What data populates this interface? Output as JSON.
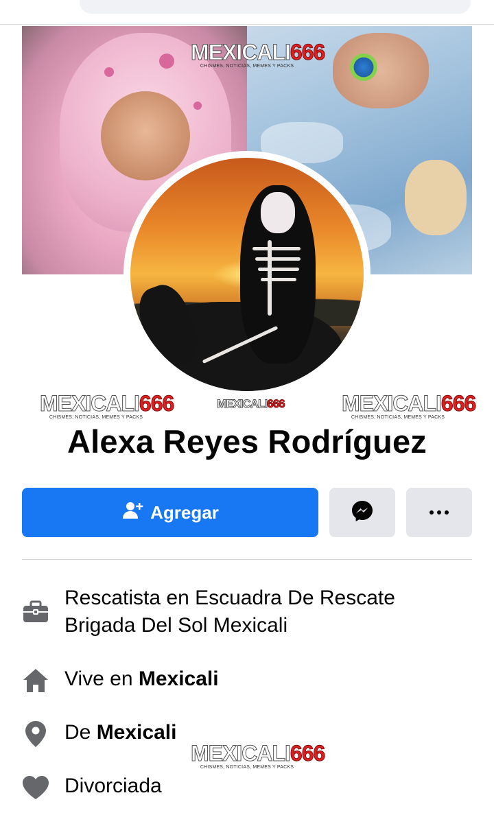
{
  "watermark": {
    "brand": "MEXICALI",
    "number": "666",
    "tagline": "CHISMES, NOTICIAS, MEMES Y PACKS"
  },
  "profile": {
    "name": "Alexa Reyes Rodríguez"
  },
  "actions": {
    "add_label": "Agregar",
    "add_icon": "add-friend-icon",
    "message_icon": "messenger-icon",
    "more_icon": "more-dots-icon"
  },
  "details": {
    "work": "Rescatista en Escuadra De Rescate Brigada Del Sol Mexicali",
    "work_line1": "Rescatista en Escuadra De Rescate",
    "work_line2": "Brigada Del Sol Mexicali",
    "lives_prefix": "Vive en ",
    "lives_city": "Mexicali",
    "from_prefix": "De ",
    "from_city": "Mexicali",
    "relationship": "Divorciada"
  },
  "colors": {
    "primary": "#1877f2",
    "secondary_button": "#e4e6eb",
    "icon_gray": "#65676b",
    "watermark_red": "#e02020"
  }
}
